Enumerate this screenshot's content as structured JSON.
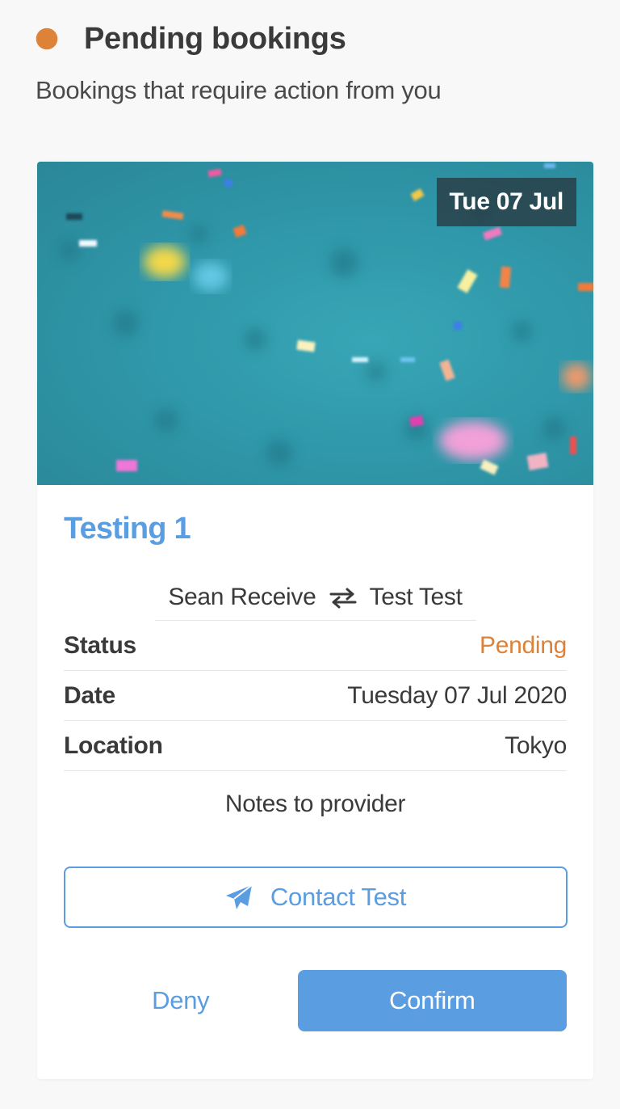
{
  "header": {
    "status_color": "#dd8237",
    "title": "Pending bookings",
    "subtitle": "Bookings that require action from you"
  },
  "booking": {
    "image_description": "teal background with falling confetti",
    "date_badge": "Tue 07 Jul",
    "title": "Testing 1",
    "parties": {
      "from": "Sean Receive",
      "to": "Test Test",
      "icon": "swap-arrows-icon"
    },
    "details": [
      {
        "label": "Status",
        "value": "Pending",
        "color": "#dd8237"
      },
      {
        "label": "Date",
        "value": "Tuesday 07 Jul 2020"
      },
      {
        "label": "Location",
        "value": "Tokyo"
      }
    ],
    "notes_label": "Notes to provider",
    "contact_button": {
      "label": "Contact Test",
      "icon": "paper-plane-icon"
    },
    "deny_label": "Deny",
    "confirm_label": "Confirm"
  },
  "colors": {
    "accent": "#5a9de0",
    "pending": "#dd8237",
    "background": "#f8f8f8"
  }
}
